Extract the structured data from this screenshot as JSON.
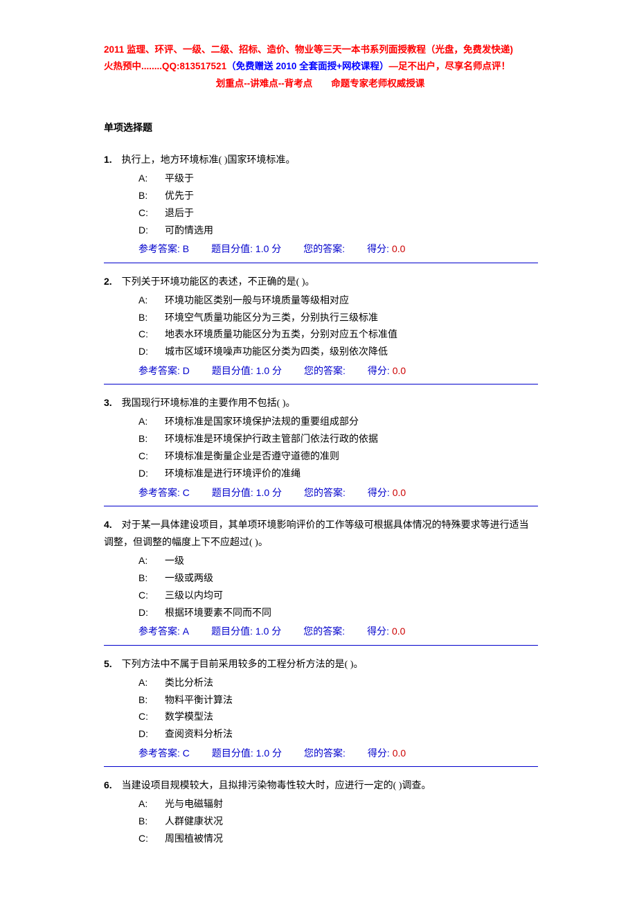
{
  "banner": {
    "line1": "2011 监理、环评、一级、二级、招标、造价、物业等三天一本书系列面授教程（光盘，免费发快递)",
    "line2_red1": "火热预中........QQ:813517521",
    "line2_blue": "（免费赠送 2010 全套面授+网校课程）",
    "line2_red2": "—足不出户，尽享名师点评！",
    "line3": "划重点--讲难点--背考点　　命题专家老师权威授课"
  },
  "section_title": "单项选择题",
  "meta_labels": {
    "ref": "参考答案: ",
    "value_label": "题目分值: ",
    "value_unit": " 分",
    "your": "您的答案:",
    "score": "得分: "
  },
  "questions": [
    {
      "num": "1.",
      "stem": "执行上，地方环境标准( )国家环境标准。",
      "options": [
        {
          "k": "A:",
          "t": "平级于"
        },
        {
          "k": "B:",
          "t": "优先于"
        },
        {
          "k": "C:",
          "t": "退后于"
        },
        {
          "k": "D:",
          "t": "可酌情选用"
        }
      ],
      "ref": "B",
      "val": "1.0",
      "score": "0.0"
    },
    {
      "num": "2.",
      "stem": "下列关于环境功能区的表述，不正确的是( )。",
      "options": [
        {
          "k": "A:",
          "t": "环境功能区类别一般与环境质量等级相对应"
        },
        {
          "k": "B:",
          "t": "环境空气质量功能区分为三类，分别执行三级标准"
        },
        {
          "k": "C:",
          "t": "地表水环境质量功能区分为五类，分别对应五个标准值"
        },
        {
          "k": "D:",
          "t": "城市区域环境噪声功能区分类为四类，级别依次降低"
        }
      ],
      "ref": "D",
      "val": "1.0",
      "score": "0.0"
    },
    {
      "num": "3.",
      "stem": "我国现行环境标准的主要作用不包括( )。",
      "options": [
        {
          "k": "A:",
          "t": "环境标准是国家环境保护法规的重要组成部分"
        },
        {
          "k": "B:",
          "t": "环境标准是环境保护行政主管部门依法行政的依据"
        },
        {
          "k": "C:",
          "t": "环境标准是衡量企业是否遵守道德的准则"
        },
        {
          "k": "D:",
          "t": "环境标准是进行环境评价的准绳"
        }
      ],
      "ref": "C",
      "val": "1.0",
      "score": "0.0"
    },
    {
      "num": "4.",
      "stem": "对于某一具体建设项目，其单项环境影响评价的工作等级可根据具体情况的特殊要求等进行适当调整，但调整的幅度上下不应超过( )。",
      "options": [
        {
          "k": "A:",
          "t": "一级"
        },
        {
          "k": "B:",
          "t": "一级或两级"
        },
        {
          "k": "C:",
          "t": "三级以内均可"
        },
        {
          "k": "D:",
          "t": "根据环境要素不同而不同"
        }
      ],
      "ref": "A",
      "val": "1.0",
      "score": "0.0"
    },
    {
      "num": "5.",
      "stem": "下列方法中不属于目前采用较多的工程分析方法的是( )。",
      "options": [
        {
          "k": "A:",
          "t": "类比分析法"
        },
        {
          "k": "B:",
          "t": "物料平衡计算法"
        },
        {
          "k": "C:",
          "t": "数学模型法"
        },
        {
          "k": "D:",
          "t": "查阅资料分析法"
        }
      ],
      "ref": "C",
      "val": "1.0",
      "score": "0.0"
    },
    {
      "num": "6.",
      "stem": "当建设项目规模较大，且拟排污染物毒性较大时，应进行一定的( )调查。",
      "options": [
        {
          "k": "A:",
          "t": "光与电磁辐射"
        },
        {
          "k": "B:",
          "t": "人群健康状况"
        },
        {
          "k": "C:",
          "t": "周围植被情况"
        }
      ],
      "ref": null,
      "val": null,
      "score": null
    }
  ]
}
